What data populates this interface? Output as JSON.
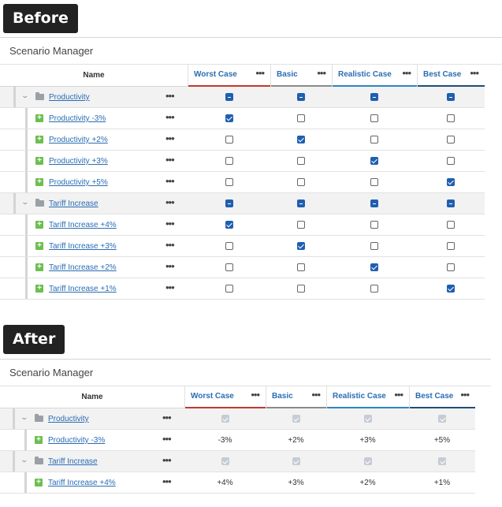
{
  "before": {
    "tag": "Before",
    "title": "Scenario Manager",
    "name_header": "Name",
    "scenarios": [
      {
        "label": "Worst Case",
        "color": "#c0392b"
      },
      {
        "label": "Basic",
        "color": "#8a8a8a"
      },
      {
        "label": "Realistic Case",
        "color": "#2e86c1"
      },
      {
        "label": "Best Case",
        "color": "#1f4e79"
      }
    ],
    "more_label": "•••",
    "groups": [
      {
        "label": "Productivity",
        "items": [
          {
            "label": "Productivity -3%",
            "checked": [
              true,
              false,
              false,
              false
            ]
          },
          {
            "label": "Productivity +2%",
            "checked": [
              false,
              true,
              false,
              false
            ]
          },
          {
            "label": "Productivity +3%",
            "checked": [
              false,
              false,
              true,
              false
            ]
          },
          {
            "label": "Productivity +5%",
            "checked": [
              false,
              false,
              false,
              true
            ]
          }
        ]
      },
      {
        "label": "Tariff Increase",
        "items": [
          {
            "label": "Tariff Increase +4%",
            "checked": [
              true,
              false,
              false,
              false
            ]
          },
          {
            "label": "Tariff Increase +3%",
            "checked": [
              false,
              true,
              false,
              false
            ]
          },
          {
            "label": "Tariff Increase +2%",
            "checked": [
              false,
              false,
              true,
              false
            ]
          },
          {
            "label": "Tariff Increase +1%",
            "checked": [
              false,
              false,
              false,
              true
            ]
          }
        ]
      }
    ]
  },
  "after": {
    "tag": "After",
    "title": "Scenario Manager",
    "name_header": "Name",
    "scenarios": [
      {
        "label": "Worst Case",
        "color": "#c0392b"
      },
      {
        "label": "Basic",
        "color": "#8a8a8a"
      },
      {
        "label": "Realistic Case",
        "color": "#2e86c1"
      },
      {
        "label": "Best Case",
        "color": "#1f4e79"
      }
    ],
    "more_label": "•••",
    "groups": [
      {
        "label": "Productivity",
        "item": {
          "label": "Productivity -3%",
          "values": [
            "-3%",
            "+2%",
            "+3%",
            "+5%"
          ]
        }
      },
      {
        "label": "Tariff Increase",
        "item": {
          "label": "Tariff Increase +4%",
          "values": [
            "+4%",
            "+3%",
            "+2%",
            "+1%"
          ]
        }
      }
    ]
  }
}
